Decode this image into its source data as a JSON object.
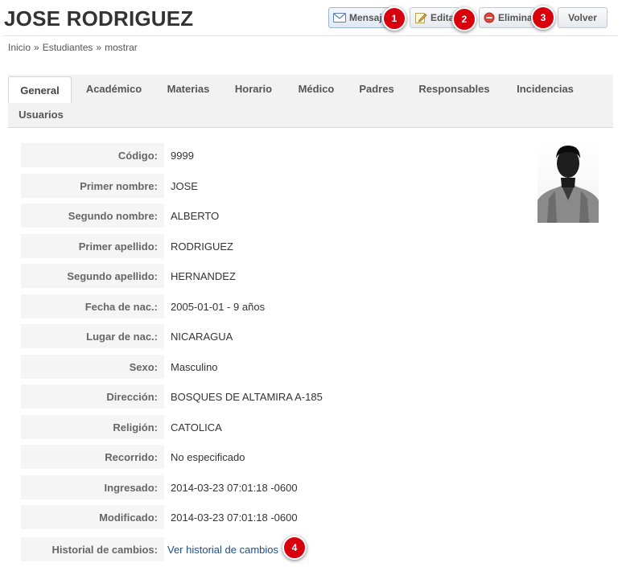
{
  "page": {
    "title": "JOSE RODRIGUEZ"
  },
  "toolbar": {
    "message_label": "Mensaje",
    "edit_label": "Editar",
    "delete_label": "Eliminar",
    "back_label": "Volver"
  },
  "markers": [
    "1",
    "2",
    "3",
    "4"
  ],
  "breadcrumb": {
    "items": [
      "Inicio",
      "Estudiantes",
      "mostrar"
    ],
    "separator": "»"
  },
  "tabs": [
    {
      "label": "General",
      "active": true
    },
    {
      "label": "Académico"
    },
    {
      "label": "Materias"
    },
    {
      "label": "Horario"
    },
    {
      "label": "Médico"
    },
    {
      "label": "Padres"
    },
    {
      "label": "Responsables"
    },
    {
      "label": "Incidencias"
    },
    {
      "label": "Usuarios"
    }
  ],
  "student": {
    "fields": [
      {
        "label": "Código:",
        "value": "9999"
      },
      {
        "label": "Primer nombre:",
        "value": "JOSE"
      },
      {
        "label": "Segundo nombre:",
        "value": "ALBERTO"
      },
      {
        "label": "Primer apellido:",
        "value": "RODRIGUEZ"
      },
      {
        "label": "Segundo apellido:",
        "value": "HERNANDEZ"
      },
      {
        "label": "Fecha de nac.:",
        "value": "2005-01-01 - 9 años"
      },
      {
        "label": "Lugar de nac.:",
        "value": "NICARAGUA"
      },
      {
        "label": "Sexo:",
        "value": "Masculino"
      },
      {
        "label": "Dirección:",
        "value": "BOSQUES DE ALTAMIRA A-185"
      },
      {
        "label": "Religión:",
        "value": "CATOLICA"
      },
      {
        "label": "Recorrido:",
        "value": "No especificado"
      },
      {
        "label": "Ingresado:",
        "value": "2014-03-23 07:01:18 -0600"
      },
      {
        "label": "Modificado:",
        "value": "2014-03-23 07:01:18 -0600"
      }
    ],
    "history": {
      "label": "Historial de cambios:",
      "link_text": "Ver historial de cambios"
    }
  },
  "icons": {
    "message": "envelope-icon",
    "edit": "pencil-icon",
    "delete": "delete-circle-icon",
    "photo": "student-photo"
  },
  "colors": {
    "marker": "#d8000c",
    "link": "#1a4f8b",
    "label_bg": "#f5f5f5",
    "tab_bar": "#f2f2f2"
  }
}
